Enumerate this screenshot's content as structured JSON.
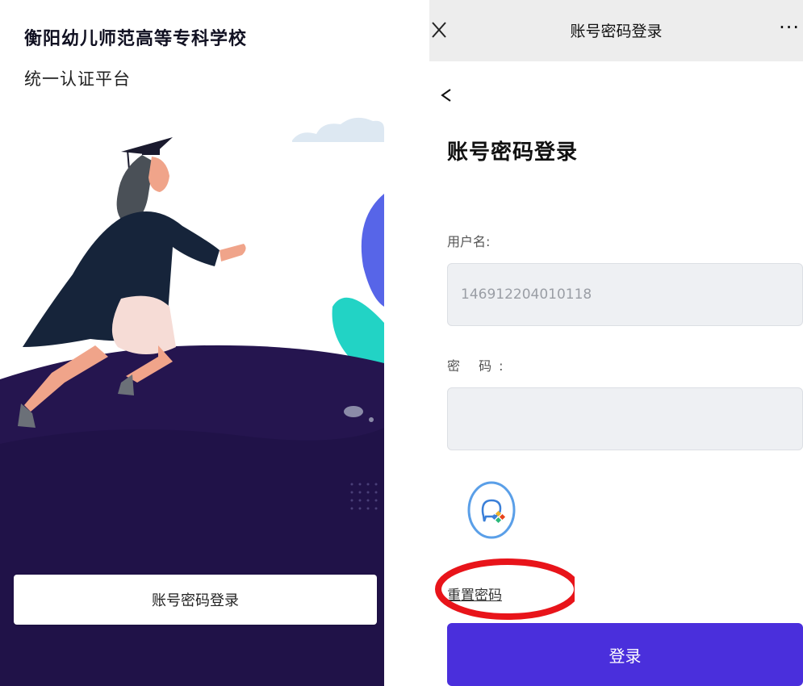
{
  "left": {
    "school_name": "衡阳幼儿师范高等专科学校",
    "platform_name": "统一认证平台",
    "login_button": "账号密码登录"
  },
  "right": {
    "topbar": {
      "close_icon": "close-icon",
      "title": "账号密码登录",
      "more_label": "···"
    },
    "back_icon": "chevron-left-icon",
    "page_title": "账号密码登录",
    "username_label": "用户名:",
    "username_value": "146912204010118",
    "password_label": "密 码:",
    "password_value": "",
    "wecom_icon": "wecom-chat-icon",
    "reset_link": "重置密码",
    "login_button": "登录"
  },
  "colors": {
    "primary": "#4a2fdc",
    "hill": "#25154f",
    "annotation": "#e8141a",
    "teal_leaf": "#22d3c5",
    "blue_leaf": "#5765e8"
  }
}
